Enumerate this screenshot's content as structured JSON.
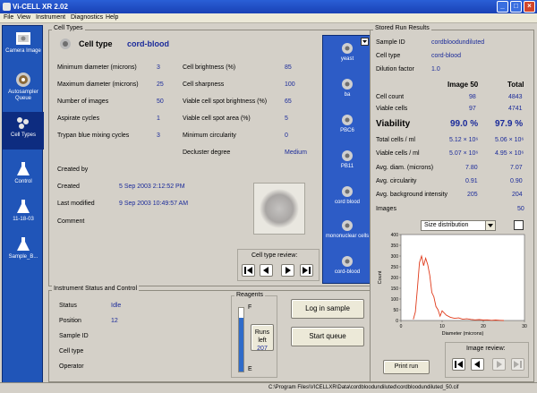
{
  "window": {
    "title": "Vi-CELL XR 2.02"
  },
  "menu": [
    "File",
    "View",
    "Instrument",
    "Diagnostics",
    "Help"
  ],
  "nav": [
    {
      "label": "Camera Image",
      "icon": "camera-icon"
    },
    {
      "label": "Autosampler Queue",
      "icon": "autosampler-icon"
    },
    {
      "label": "Cell Types",
      "icon": "cell-types-icon"
    },
    {
      "label": "Control",
      "icon": "flask-icon"
    },
    {
      "label": "11-18-03",
      "icon": "flask-icon"
    },
    {
      "label": "Sample_B...",
      "icon": "flask-icon"
    }
  ],
  "cell_types": {
    "group_label": "Cell Types",
    "heading_label": "Cell type",
    "heading_value": "cord-blood",
    "params_left": [
      {
        "label": "Minimum diameter (microns)",
        "value": "3"
      },
      {
        "label": "Maximum diameter (microns)",
        "value": "25"
      },
      {
        "label": "Number of images",
        "value": "50"
      },
      {
        "label": "Aspirate cycles",
        "value": "1"
      },
      {
        "label": "Trypan blue mixing cycles",
        "value": "3"
      }
    ],
    "params_right": [
      {
        "label": "Cell brightness (%)",
        "value": "85"
      },
      {
        "label": "Cell sharpness",
        "value": "100"
      },
      {
        "label": "Viable cell spot brightness (%)",
        "value": "65"
      },
      {
        "label": "Viable cell spot area (%)",
        "value": "5"
      },
      {
        "label": "Minimum circularity",
        "value": "0"
      },
      {
        "label": "Decluster degree",
        "value": "Medium"
      }
    ],
    "created_by_label": "Created by",
    "created_label": "Created",
    "created_value": "5 Sep 2003  2:12:52 PM",
    "modified_label": "Last modified",
    "modified_value": "9 Sep 2003  10:49:57 AM",
    "comment_label": "Comment",
    "review_label": "Cell type review:"
  },
  "cell_list": [
    "yeast",
    "ba",
    "PBC6",
    "PB11",
    "cord blood",
    "mononuclear cells",
    "cord-blood"
  ],
  "instrument": {
    "group_label": "Instrument Status and Control",
    "rows": [
      {
        "label": "Status",
        "value": "Idle"
      },
      {
        "label": "Position",
        "value": "12"
      },
      {
        "label": "Sample ID",
        "value": ""
      },
      {
        "label": "Cell type",
        "value": ""
      },
      {
        "label": "Operator",
        "value": ""
      }
    ]
  },
  "reagents": {
    "label": "Reagents",
    "full": "F",
    "empty": "E",
    "runs_left_label": "Runs left",
    "runs_left_value": "207",
    "level": 0.85
  },
  "buttons": {
    "log_in_sample": "Log in sample",
    "start_queue": "Start queue",
    "print_run": "Print run"
  },
  "stored": {
    "group_label": "Stored Run Results",
    "sample_id_label": "Sample ID",
    "sample_id_value": "cordbloodundiluted",
    "cell_type_label": "Cell type",
    "cell_type_value": "cord-blood",
    "dilution_label": "Dilution factor",
    "dilution_value": "1.0",
    "col_image": "Image 50",
    "col_total": "Total",
    "rows": [
      {
        "label": "Cell count",
        "image": "98",
        "total": "4843"
      },
      {
        "label": "Viable cells",
        "image": "97",
        "total": "4741"
      }
    ],
    "viability_label": "Viability",
    "viability_image": "99.0 %",
    "viability_total": "97.9 %",
    "rows2": [
      {
        "label": "Total cells / ml",
        "image": "5.12 × 10⁶",
        "total": "5.06 × 10⁶"
      },
      {
        "label": "Viable cells / ml",
        "image": "5.07 × 10⁶",
        "total": "4.95 × 10⁶"
      },
      {
        "label": "Avg. diam. (microns)",
        "image": "7.80",
        "total": "7.07"
      },
      {
        "label": "Avg. circularity",
        "image": "0.91",
        "total": "0.90"
      },
      {
        "label": "Avg. background intensity",
        "image": "205",
        "total": "204"
      },
      {
        "label": "Images",
        "image": "",
        "total": "50"
      }
    ],
    "dropdown_value": "Size distribution",
    "image_review_label": "Image review:"
  },
  "chart_data": {
    "type": "line",
    "xlabel": "Diameter (microns)",
    "ylabel": "Count",
    "xlim": [
      0,
      30
    ],
    "ylim": [
      0,
      400
    ],
    "x_ticks": [
      0,
      10,
      20,
      30
    ],
    "y_ticks": [
      0,
      50,
      100,
      150,
      200,
      250,
      300,
      350,
      400
    ],
    "x": [
      3,
      3.5,
      4,
      4.5,
      5,
      5.5,
      6,
      6.5,
      7,
      7.5,
      8,
      8.5,
      9,
      9.5,
      10,
      11,
      12,
      13,
      14,
      15,
      16,
      17,
      18,
      19,
      20,
      21,
      22,
      23,
      24,
      25
    ],
    "values": [
      5,
      40,
      150,
      270,
      300,
      255,
      290,
      260,
      210,
      130,
      110,
      65,
      50,
      20,
      45,
      25,
      15,
      10,
      12,
      6,
      8,
      5,
      3,
      4,
      2,
      3,
      1,
      2,
      1,
      0
    ],
    "color": "#e03a1a"
  },
  "statusbar": {
    "path": "C:\\Program Files\\VICELLXR\\Data\\cordbloodundiluted\\cordbloodundiluted_50.cif"
  },
  "colors": {
    "nav_bg": "#2055b8",
    "value_blue": "#1a2a9a",
    "series": "#e03a1a"
  }
}
